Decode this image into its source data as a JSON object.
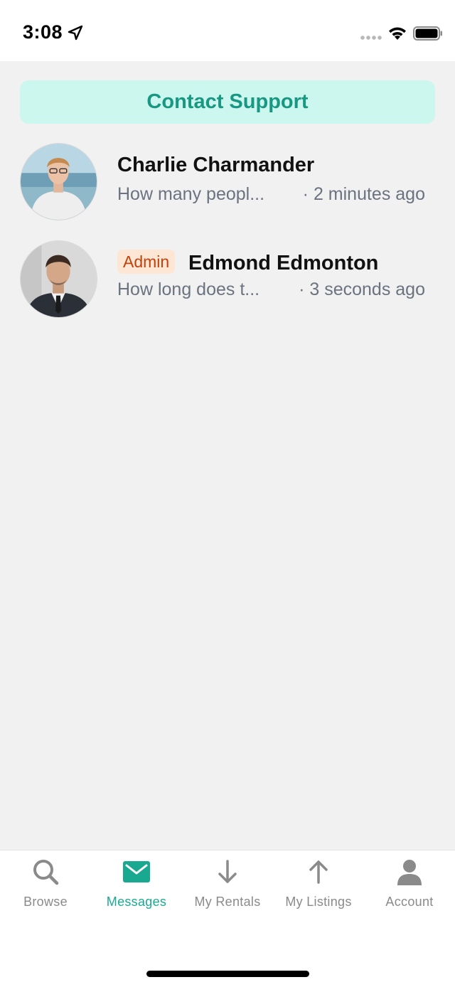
{
  "status_bar": {
    "time": "3:08"
  },
  "support_button": {
    "label": "Contact Support"
  },
  "conversations": [
    {
      "name": "Charlie Charmander",
      "preview": "How many peopl...",
      "time": "· 2 minutes ago",
      "badge": ""
    },
    {
      "name": "Edmond Edmonton",
      "preview": "How long does t...",
      "time": "· 3 seconds ago",
      "badge": "Admin"
    }
  ],
  "tabs": [
    {
      "label": "Browse",
      "icon": "search-icon",
      "active": false
    },
    {
      "label": "Messages",
      "icon": "envelope-icon",
      "active": true
    },
    {
      "label": "My Rentals",
      "icon": "arrow-down-icon",
      "active": false
    },
    {
      "label": "My Listings",
      "icon": "arrow-up-icon",
      "active": false
    },
    {
      "label": "Account",
      "icon": "person-icon",
      "active": false
    }
  ],
  "colors": {
    "accent": "#19a991",
    "support_bg": "#ccf7ee",
    "support_text": "#189883",
    "badge_bg": "#fde7d4",
    "badge_text": "#c2410c",
    "inactive_tab": "#8a8a8a",
    "background": "#f1f1f1"
  }
}
